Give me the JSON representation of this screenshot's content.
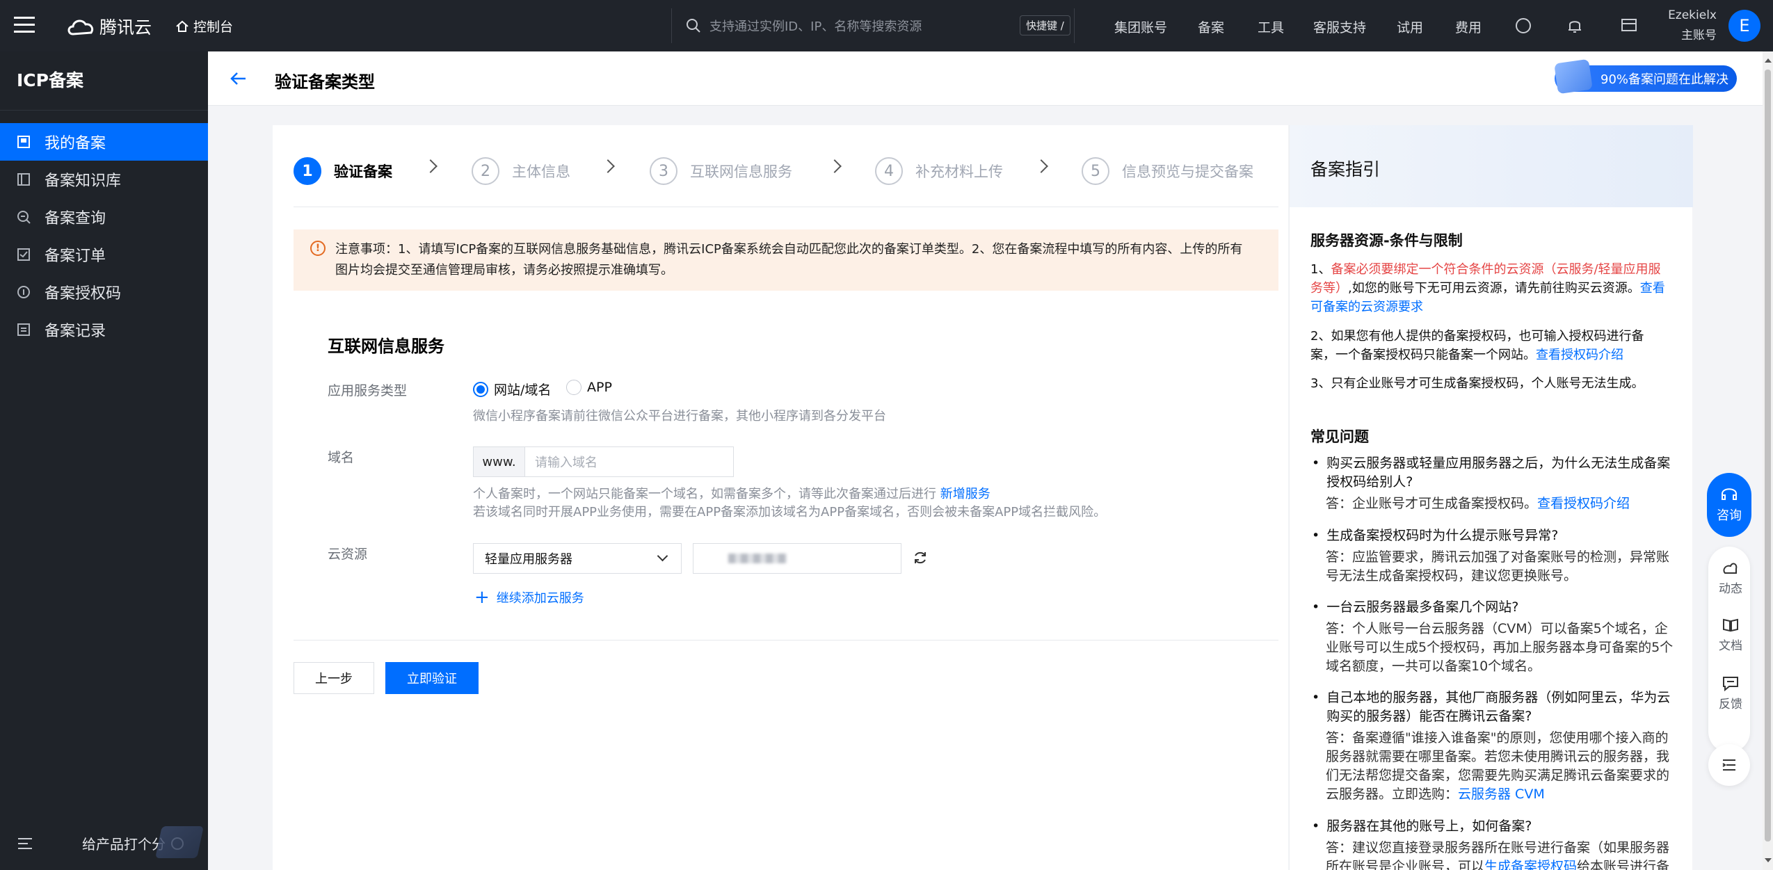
{
  "topbar": {
    "brand": "腾讯云",
    "console": "控制台",
    "search_placeholder": "支持通过实例ID、IP、名称等搜索资源",
    "shortcut": "快捷键 /",
    "nav": [
      "集团账号",
      "备案",
      "工具",
      "客服支持",
      "试用",
      "费用"
    ],
    "user_name": "Ezekielx",
    "user_role": "主账号",
    "avatar_letter": "E"
  },
  "sidebar": {
    "title": "ICP备案",
    "items": [
      {
        "label": "我的备案",
        "icon": "my-filing-icon"
      },
      {
        "label": "备案知识库",
        "icon": "knowledge-icon"
      },
      {
        "label": "备案查询",
        "icon": "query-icon"
      },
      {
        "label": "备案订单",
        "icon": "order-icon"
      },
      {
        "label": "备案授权码",
        "icon": "auth-code-icon"
      },
      {
        "label": "备案记录",
        "icon": "record-icon"
      }
    ],
    "rate_label": "给产品打个分"
  },
  "header": {
    "title": "验证备案类型",
    "promo": "90%备案问题在此解决"
  },
  "steps": [
    {
      "num": "1",
      "label": "验证备案"
    },
    {
      "num": "2",
      "label": "主体信息"
    },
    {
      "num": "3",
      "label": "互联网信息服务"
    },
    {
      "num": "4",
      "label": "补充材料上传"
    },
    {
      "num": "5",
      "label": "信息预览与提交备案"
    }
  ],
  "notice": {
    "line1": "注意事项：1、请填写ICP备案的互联网信息服务基础信息，腾讯云ICP备案系统会自动匹配您此次的备案订单类型。2、您在备案流程中填写的所有内容、上传的所有",
    "line2": "图片均会提交至通信管理局审核，请务必按照提示准确填写。"
  },
  "form": {
    "section_title": "互联网信息服务",
    "service_type_label": "应用服务类型",
    "option_website": "网站/域名",
    "option_app": "APP",
    "service_hint": "微信小程序备案请前往微信公众平台进行备案，其他小程序请到各分发平台",
    "domain_label": "域名",
    "domain_prefix": "www.",
    "domain_placeholder": "请输入域名",
    "domain_hint1": "个人备案时，一个网站只能备案一个域名，如需备案多个，请等此次备案通过后进行",
    "domain_hint1_link": "新增服务",
    "domain_hint2": "若该域名同时开展APP业务使用，需要在APP备案添加该域名为APP备案域名，否则会被未备案APP域名拦截风险。",
    "cloud_label": "云资源",
    "cloud_select": "轻量应用服务器",
    "add_service": "继续添加云服务",
    "prev_button": "上一步",
    "verify_button": "立即验证"
  },
  "guide": {
    "title": "备案指引",
    "section1_title": "服务器资源-条件与限制",
    "item1_pre": "1、",
    "item1_red": "备案必须要绑定一个符合条件的云资源（云服务/轻量应用服务等）",
    "item1_rest": ",如您的账号下无可用云资源，请先前往购买云资源。",
    "item1_link": "查看可备案的云资源要求",
    "item2": "2、如果您有他人提供的备案授权码，也可输入授权码进行备案，一个备案授权码只能备案一个网站。",
    "item2_link": "查看授权码介绍",
    "item3": "3、只有企业账号才可生成备案授权码，个人账号无法生成。",
    "faq_title": "常见问题",
    "faq": [
      {
        "q": "购买云服务器或轻量应用服务器之后，为什么无法生成备案授权码给别人?",
        "a": "答：企业账号才可生成备案授权码。",
        "link": "查看授权码介绍"
      },
      {
        "q": "生成备案授权码时为什么提示账号异常?",
        "a": "答：应监管要求，腾讯云加强了对备案账号的检测，异常账号无法生成备案授权码，建议您更换账号。",
        "link": ""
      },
      {
        "q": "一台云服务器最多备案几个网站?",
        "a": "答：个人账号一台云服务器（CVM）可以备案5个域名，企业账号可以生成5个授权码，再加上服务器本身可备案的5个域名额度，一共可以备案10个域名。",
        "link": ""
      },
      {
        "q": "自己本地的服务器，其他厂商服务器（例如阿里云，华为云购买的服务器）能否在腾讯云备案?",
        "a": "答：备案遵循\"谁接入谁备案\"的原则，您使用哪个接入商的服务器就需要在哪里备案。若您未使用腾讯云的服务器，我们无法帮您提交备案，您需要先购买满足腾讯云备案要求的云服务器。立即选购：",
        "link": "云服务器 CVM"
      },
      {
        "q": "服务器在其他的账号上，如何备案?",
        "a": "答：建议您直接登录服务器所在账号进行备案（如果服务器所在账号是企业账号，可以",
        "link": "生成备案授权码",
        "tail": "给本账号进行备案）"
      }
    ]
  },
  "floating": {
    "consult": "咨询",
    "news": "动态",
    "docs": "文档",
    "feedback": "反馈"
  }
}
